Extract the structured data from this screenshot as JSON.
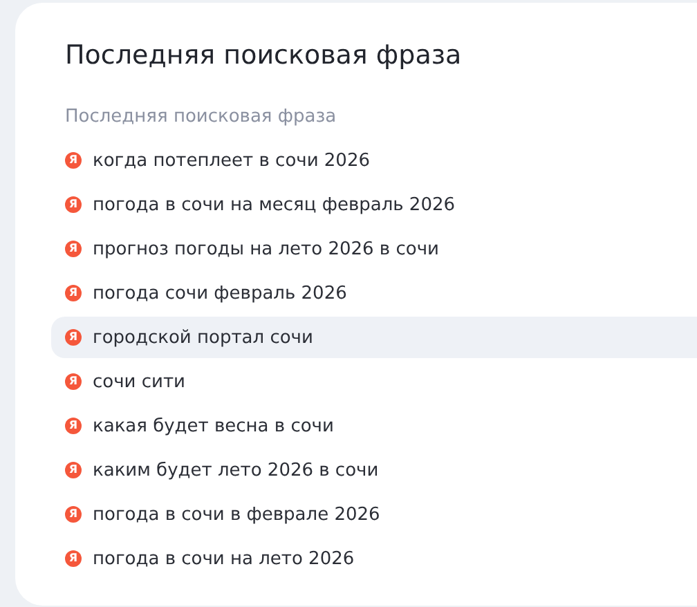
{
  "card": {
    "title": "Последняя поисковая фраза",
    "subtitle": "Последняя поисковая фраза",
    "items": [
      {
        "text": "когда потеплеет в сочи 2026",
        "icon": "Я",
        "selected": false
      },
      {
        "text": "погода в сочи на месяц февраль 2026",
        "icon": "Я",
        "selected": false
      },
      {
        "text": "прогноз погоды на лето 2026 в сочи",
        "icon": "Я",
        "selected": false
      },
      {
        "text": "погода сочи февраль 2026",
        "icon": "Я",
        "selected": false
      },
      {
        "text": "городской портал сочи",
        "icon": "Я",
        "selected": true
      },
      {
        "text": "сочи сити",
        "icon": "Я",
        "selected": false
      },
      {
        "text": "какая будет весна в сочи",
        "icon": "Я",
        "selected": false
      },
      {
        "text": "каким будет лето 2026 в сочи",
        "icon": "Я",
        "selected": false
      },
      {
        "text": "погода в сочи в феврале 2026",
        "icon": "Я",
        "selected": false
      },
      {
        "text": "погода в сочи на лето 2026",
        "icon": "Я",
        "selected": false
      }
    ]
  }
}
